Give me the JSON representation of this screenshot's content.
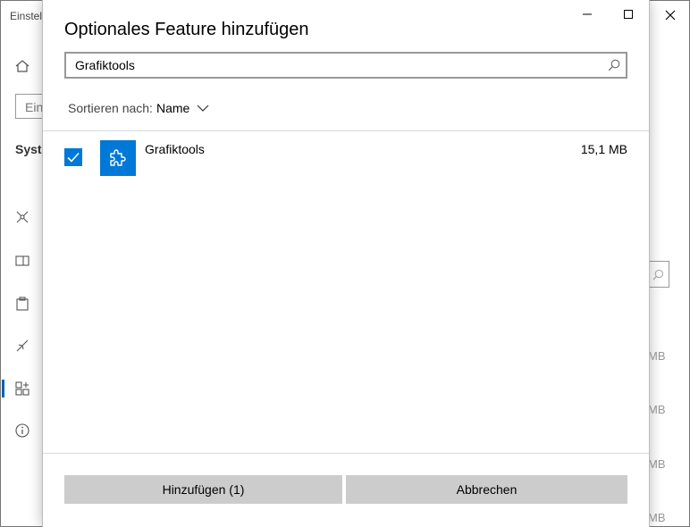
{
  "background_window": {
    "title": "Einstellungen",
    "search_placeholder": "Einstellung suchen",
    "section": "System",
    "sizes": [
      "MB",
      "MB",
      "MB",
      "MB"
    ],
    "nav_icons": [
      "home-icon",
      "network-icon",
      "display-icon",
      "clipboard-icon",
      "remote-icon",
      "optional-features-icon",
      "info-icon"
    ]
  },
  "dialog": {
    "title": "Optionales Feature hinzufügen",
    "search": {
      "value": "Grafiktools",
      "icon": "search-icon"
    },
    "sort": {
      "label": "Sortieren nach:",
      "value": "Name"
    },
    "features": [
      {
        "name": "Grafiktools",
        "size": "15,1 MB",
        "checked": true,
        "icon": "puzzle-icon"
      }
    ],
    "buttons": {
      "add": "Hinzufügen (1)",
      "cancel": "Abbrechen"
    },
    "window_controls": [
      "minimize-icon",
      "maximize-icon",
      "close-icon"
    ]
  },
  "colors": {
    "accent": "#0078d7",
    "button_bg": "#cccccc",
    "divider": "#d9d9d9"
  }
}
